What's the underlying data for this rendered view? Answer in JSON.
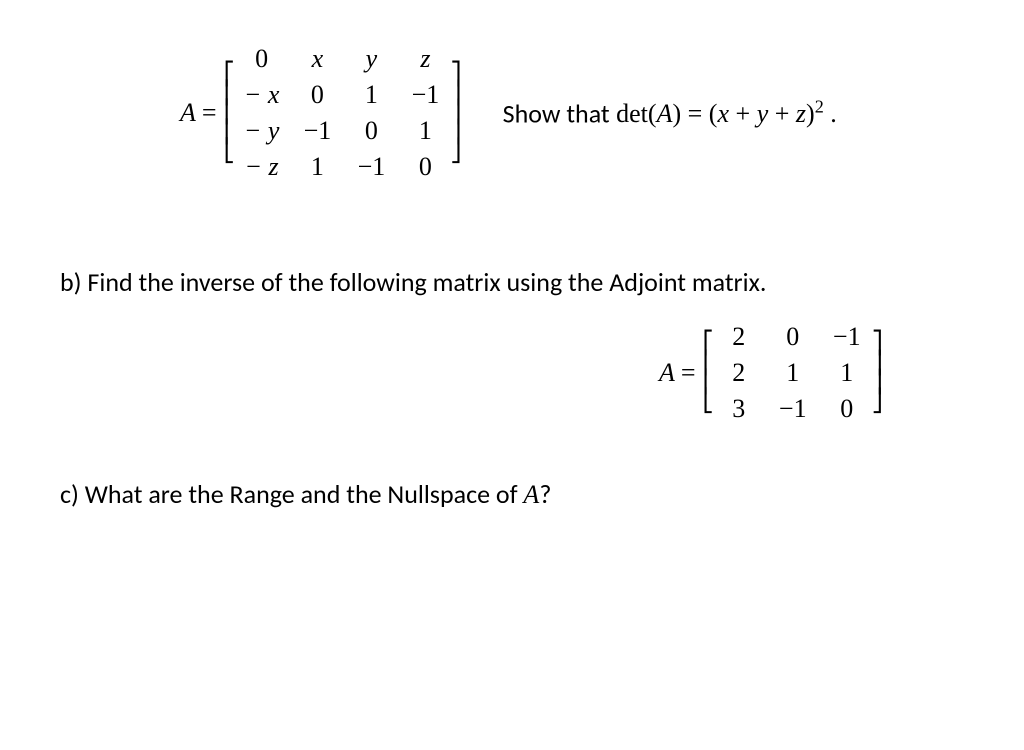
{
  "partA": {
    "lhs": "A",
    "eq": "=",
    "matrix": [
      [
        "0",
        "x",
        "y",
        "z"
      ],
      [
        "− x",
        "0",
        "1",
        "−1"
      ],
      [
        "− y",
        "−1",
        "0",
        "1"
      ],
      [
        "− z",
        "1",
        "−1",
        "0"
      ]
    ],
    "show_label": "Show that",
    "det_lhs": "det(",
    "det_var": "A",
    "det_rparen": ")",
    "det_eq": "=",
    "det_lpar": "(",
    "det_x": "x",
    "det_plus1": " + ",
    "det_y": "y",
    "det_plus2": " + ",
    "det_z": "z",
    "det_rpar2": ")",
    "det_exp": "2",
    "det_period": " ."
  },
  "partB": {
    "label": "b) Find the inverse of the following matrix using the Adjoint matrix.",
    "lhs": "A",
    "eq": "=",
    "matrix": [
      [
        "2",
        "0",
        "−1"
      ],
      [
        "2",
        "1",
        "1"
      ],
      [
        "3",
        "−1",
        "0"
      ]
    ]
  },
  "partC": {
    "label_before": "c) What are the Range and the Nullspace of ",
    "var": "A",
    "label_after": "?"
  },
  "brackets": {
    "l4": [
      "⎡",
      "⎢",
      "⎢",
      "⎢",
      "⎣"
    ],
    "r4": [
      "⎤",
      "⎥",
      "⎥",
      "⎥",
      "⎦"
    ],
    "l3": [
      "⎡",
      "⎢",
      "⎢",
      "⎣"
    ],
    "r3": [
      "⎤",
      "⎥",
      "⎥",
      "⎦"
    ]
  }
}
